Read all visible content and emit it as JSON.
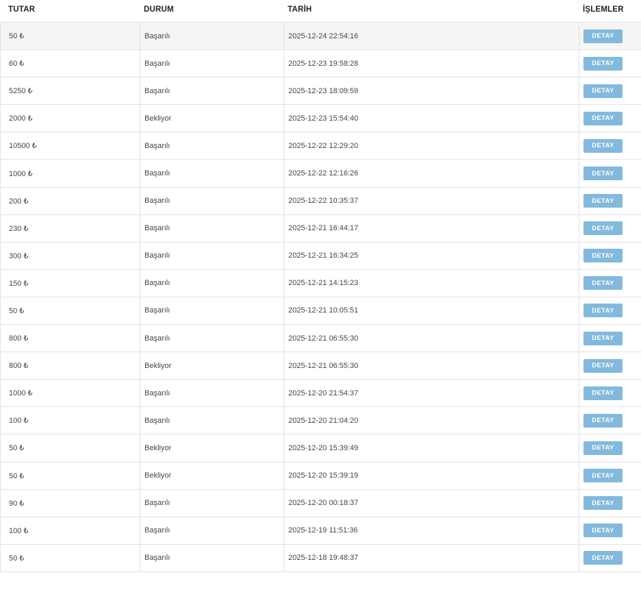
{
  "columns": {
    "amount": "TUTAR",
    "status": "DURUM",
    "date": "TARİH",
    "actions": "İŞLEMLER"
  },
  "action_label": "DETAY",
  "rows": [
    {
      "amount": "50 ₺",
      "status": "Başarılı",
      "date": "2025-12-24 22:54:16"
    },
    {
      "amount": "60 ₺",
      "status": "Başarılı",
      "date": "2025-12-23 19:58:28"
    },
    {
      "amount": "5250 ₺",
      "status": "Başarılı",
      "date": "2025-12-23 18:09:59"
    },
    {
      "amount": "2000 ₺",
      "status": "Bekliyor",
      "date": "2025-12-23 15:54:40"
    },
    {
      "amount": "10500 ₺",
      "status": "Başarılı",
      "date": "2025-12-22 12:29:20"
    },
    {
      "amount": "1000 ₺",
      "status": "Başarılı",
      "date": "2025-12-22 12:16:26"
    },
    {
      "amount": "200 ₺",
      "status": "Başarılı",
      "date": "2025-12-22 10:35:37"
    },
    {
      "amount": "230 ₺",
      "status": "Başarılı",
      "date": "2025-12-21 16:44:17"
    },
    {
      "amount": "300 ₺",
      "status": "Başarılı",
      "date": "2025-12-21 16:34:25"
    },
    {
      "amount": "150 ₺",
      "status": "Başarılı",
      "date": "2025-12-21 14:15:23"
    },
    {
      "amount": "50 ₺",
      "status": "Başarılı",
      "date": "2025-12-21 10:05:51"
    },
    {
      "amount": "800 ₺",
      "status": "Başarılı",
      "date": "2025-12-21 06:55:30"
    },
    {
      "amount": "800 ₺",
      "status": "Bekliyor",
      "date": "2025-12-21 06:55:30"
    },
    {
      "amount": "1000 ₺",
      "status": "Başarılı",
      "date": "2025-12-20 21:54:37"
    },
    {
      "amount": "100 ₺",
      "status": "Başarılı",
      "date": "2025-12-20 21:04:20"
    },
    {
      "amount": "50 ₺",
      "status": "Bekliyor",
      "date": "2025-12-20 15:39:49"
    },
    {
      "amount": "50 ₺",
      "status": "Bekliyor",
      "date": "2025-12-20 15:39:19"
    },
    {
      "amount": "90 ₺",
      "status": "Başarılı",
      "date": "2025-12-20 00:18:37"
    },
    {
      "amount": "100 ₺",
      "status": "Başarılı",
      "date": "2025-12-19 11:51:36"
    },
    {
      "amount": "50 ₺",
      "status": "Başarılı",
      "date": "2025-12-18 19:48:37"
    }
  ],
  "colors": {
    "button_bg": "#82b9dc",
    "button_text": "#ffffff",
    "row_highlight": "#f5f5f5",
    "border": "#e2e2e2"
  }
}
